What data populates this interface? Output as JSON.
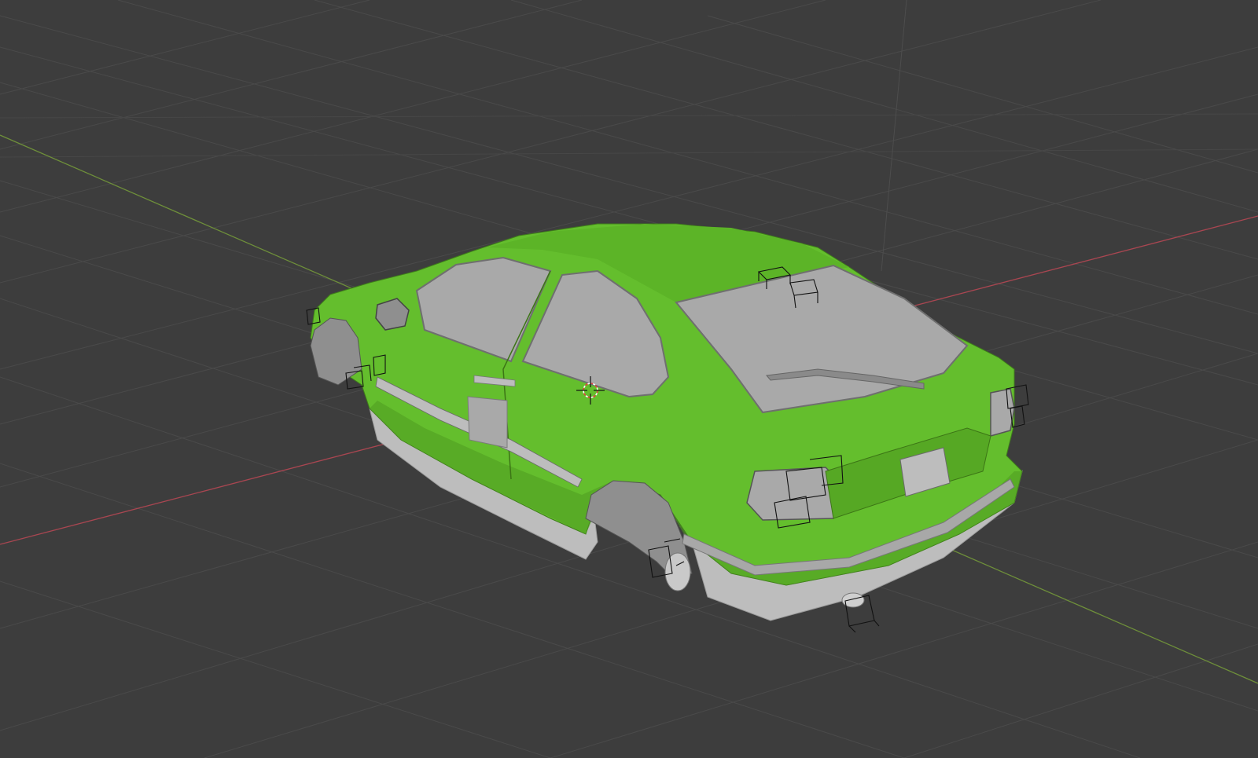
{
  "app": {
    "name": "3D viewport",
    "shading": "solid"
  },
  "scene": {
    "colors": {
      "background": "#3d3d3d",
      "grid": "#4a4a4a",
      "axis_x": "#a94651",
      "axis_y": "#6e8f3a",
      "axis_z": "#4d4d4d",
      "body_paint": "#64be2d",
      "body_paint_shadow": "#4e9b20",
      "glass": "#a9a9a9",
      "trim": "#bdbdbd",
      "empty_wire": "#111111"
    },
    "objects": [
      {
        "name": "car-body",
        "type": "mesh"
      },
      {
        "name": "empties",
        "type": "empty"
      },
      {
        "name": "3d-cursor",
        "type": "cursor"
      }
    ]
  }
}
